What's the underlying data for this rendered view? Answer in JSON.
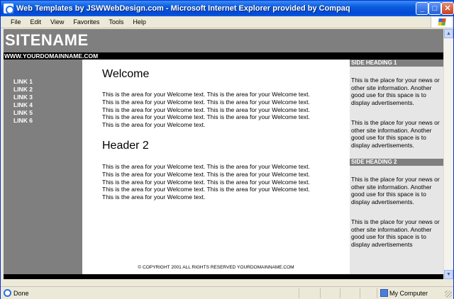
{
  "window": {
    "title": "Web Templates by JSWWebDesign.com - Microsoft Internet Explorer provided by Compaq",
    "buttons": {
      "minimize": "_",
      "maximize": "□",
      "close": "✕"
    }
  },
  "menu": {
    "items": [
      {
        "label": "File"
      },
      {
        "label": "Edit"
      },
      {
        "label": "View"
      },
      {
        "label": "Favorites"
      },
      {
        "label": "Tools"
      },
      {
        "label": "Help"
      }
    ]
  },
  "page": {
    "sitename": "SITENAME",
    "domain": "WWW.YOURDOMAINNAME.COM",
    "links": [
      {
        "label": "LINK 1"
      },
      {
        "label": "LINK 2"
      },
      {
        "label": "LINK 3"
      },
      {
        "label": "LINK 4"
      },
      {
        "label": "LINK 5"
      },
      {
        "label": "LINK 6"
      }
    ],
    "welcome_heading": "Welcome",
    "welcome_text": "This is the area for your Welcome text. This is the area for your Welcome text.\nThis is the area for your Welcome text. This is the area for your Welcome text.\nThis is the area for your Welcome text. This is the area for your Welcome text.\nThis is the area for your Welcome text. This is the area for your Welcome text.\nThis is the area for your Welcome text.",
    "header2": "Header 2",
    "header2_text": "This is the area for your Welcome text. This is the area for your Welcome text.\nThis is the area for your Welcome text. This is the area for your Welcome text.\nThis is the area for your Welcome text. This is the area for your Welcome text.\nThis is the area for your Welcome text. This is the area for your Welcome text.\nThis is the area for your Welcome text.",
    "copyright": "© COPYRIGHT 2001 ALL RIGHTS RESERVED YOURDOMAINNAME.COM",
    "side_heading_1": "SIDE HEADING 1",
    "side_1_text_a": "This is the place for your news or other site information. Another good use for this space is to display advertisements.",
    "side_1_text_b": "This is the place for your news or other site information. Another good use for this space is to display advertisements.",
    "side_heading_2": "SIDE HEADING 2",
    "side_2_text_a": "This is the place for your news or other site information. Another good use for this space is to display advertisements.",
    "side_2_text_b": "This is the place for your news or other site information. Another good use for this space is to display advertisements"
  },
  "status": {
    "text": "Done",
    "zone": "My Computer"
  },
  "icons": {
    "title": "ie-icon",
    "status": "ie-page-icon",
    "zone": "my-computer-icon"
  }
}
